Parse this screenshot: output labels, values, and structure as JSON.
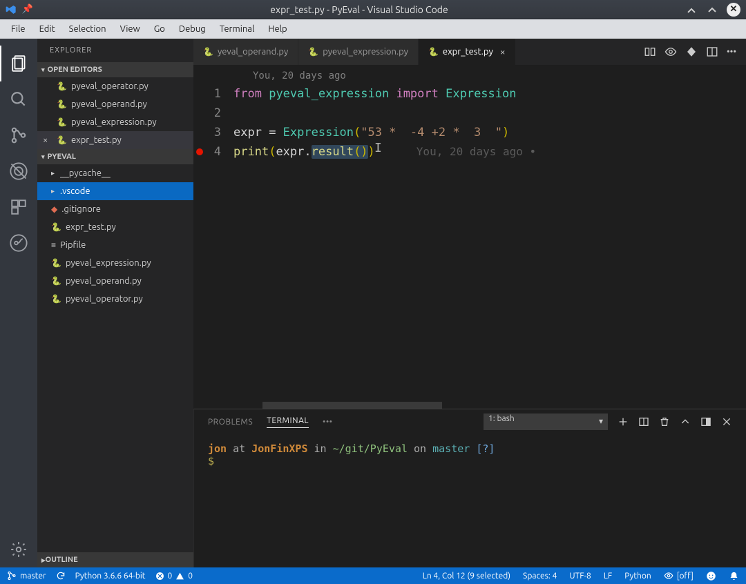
{
  "window": {
    "title": "expr_test.py - PyEval - Visual Studio Code"
  },
  "menubar": [
    "File",
    "Edit",
    "Selection",
    "View",
    "Go",
    "Debug",
    "Terminal",
    "Help"
  ],
  "explorer": {
    "title": "EXPLORER",
    "open_editors_label": "OPEN EDITORS",
    "open_editors": [
      {
        "name": "pyeval_operator.py"
      },
      {
        "name": "pyeval_operand.py"
      },
      {
        "name": "pyeval_expression.py"
      },
      {
        "name": "expr_test.py",
        "active": true
      }
    ],
    "workspace_label": "PYEVAL",
    "tree": [
      {
        "type": "folder",
        "name": "__pycache__"
      },
      {
        "type": "folder",
        "name": ".vscode",
        "selected": true
      },
      {
        "type": "file",
        "name": ".gitignore",
        "icon": "git"
      },
      {
        "type": "file",
        "name": "expr_test.py",
        "icon": "py"
      },
      {
        "type": "file",
        "name": "Pipfile",
        "icon": "text"
      },
      {
        "type": "file",
        "name": "pyeval_expression.py",
        "icon": "py"
      },
      {
        "type": "file",
        "name": "pyeval_operand.py",
        "icon": "py"
      },
      {
        "type": "file",
        "name": "pyeval_operator.py",
        "icon": "py"
      }
    ],
    "outline_label": "OUTLINE"
  },
  "tabs": [
    {
      "label": "yeval_operand.py",
      "kind": "py"
    },
    {
      "label": "pyeval_expression.py",
      "kind": "py"
    },
    {
      "label": "expr_test.py",
      "kind": "py",
      "active": true,
      "dirty": false
    }
  ],
  "editor": {
    "codelens": "You, 20 days ago",
    "lines": {
      "l1_from": "from",
      "l1_mod": "pyeval_expression",
      "l1_import": "import",
      "l1_cls": "Expression",
      "l3_lhs": "expr",
      "l3_eq": " = ",
      "l3_cls": "Expression",
      "l3_str": "\"53 *  -4 +2 *  3  \"",
      "l4_fn": "print",
      "l4_obj": "expr",
      "l4_dot": ".",
      "l4_method": "result",
      "hint": "You, 20 days ago •"
    },
    "line_numbers": [
      "1",
      "2",
      "3",
      "4"
    ]
  },
  "panel": {
    "tabs": {
      "problems": "PROBLEMS",
      "terminal": "TERMINAL",
      "more": "•••"
    },
    "term_select": "1: bash",
    "prompt": {
      "user": "jon",
      "at": "at",
      "host": "JonFinXPS",
      "in": "in",
      "path": "~/git/PyEval",
      "on": "on",
      "branch": "master",
      "flag": "[?]",
      "ps": "$"
    }
  },
  "status": {
    "branch": "master",
    "python": "Python 3.6.6 64-bit",
    "errors": "0",
    "warnings": "0",
    "cursor": "Ln 4, Col 12 (9 selected)",
    "spaces": "Spaces: 4",
    "encoding": "UTF-8",
    "eol": "LF",
    "lang": "Python",
    "liveshare": "[off]"
  }
}
